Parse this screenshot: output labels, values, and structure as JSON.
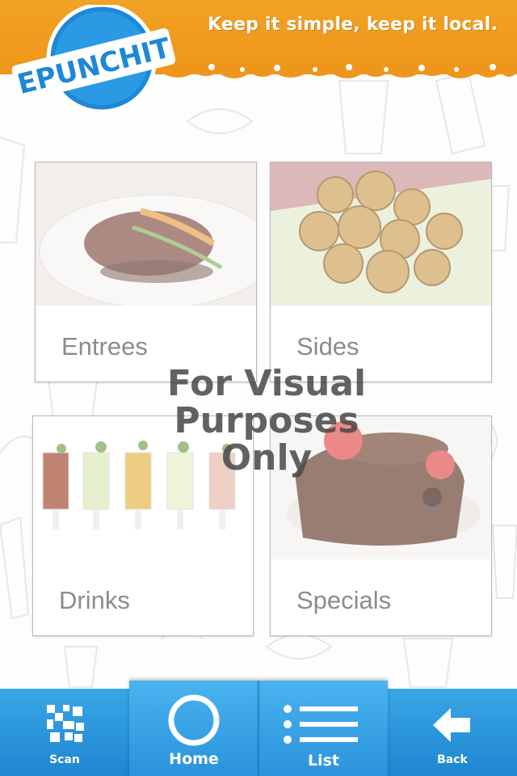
{
  "header": {
    "logo_text": "EPUNCHIT",
    "tagline": "Keep it simple, keep it local."
  },
  "menu": {
    "tiles": [
      {
        "label": "Entrees"
      },
      {
        "label": "Sides"
      },
      {
        "label": "Drinks"
      },
      {
        "label": "Specials"
      }
    ]
  },
  "watermark": {
    "line1": "For Visual",
    "line2": "Purposes",
    "line3": "Only"
  },
  "navbar": {
    "items": [
      {
        "label": "Scan",
        "icon": "qr-code-icon"
      },
      {
        "label": "Home",
        "icon": "circle-icon"
      },
      {
        "label": "List",
        "icon": "list-icon"
      },
      {
        "label": "Back",
        "icon": "arrow-left-icon"
      }
    ]
  },
  "colors": {
    "header_orange": "#ee961b",
    "nav_blue": "#2a93dc",
    "logo_blue": "#1e88d6",
    "label_gray": "#8c8c8c"
  }
}
